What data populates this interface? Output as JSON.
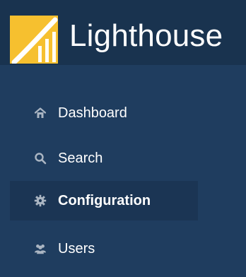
{
  "brand": {
    "title": "Lighthouse",
    "logo_icon": "lighthouse-chart-logo",
    "logo_color": "#f6c02f"
  },
  "nav": {
    "items": [
      {
        "label": "Dashboard",
        "icon": "home-icon",
        "active": false
      },
      {
        "label": "Search",
        "icon": "search-icon",
        "active": false
      },
      {
        "label": "Configuration",
        "icon": "gear-icon",
        "active": true
      },
      {
        "label": "Users",
        "icon": "users-icon",
        "active": false
      }
    ]
  },
  "colors": {
    "sidebar_bg": "#1f3d5f",
    "brand_bg": "#19334f",
    "active_bg": "#1b3554",
    "icon_gray": "#aab5c2",
    "text": "#ffffff"
  }
}
